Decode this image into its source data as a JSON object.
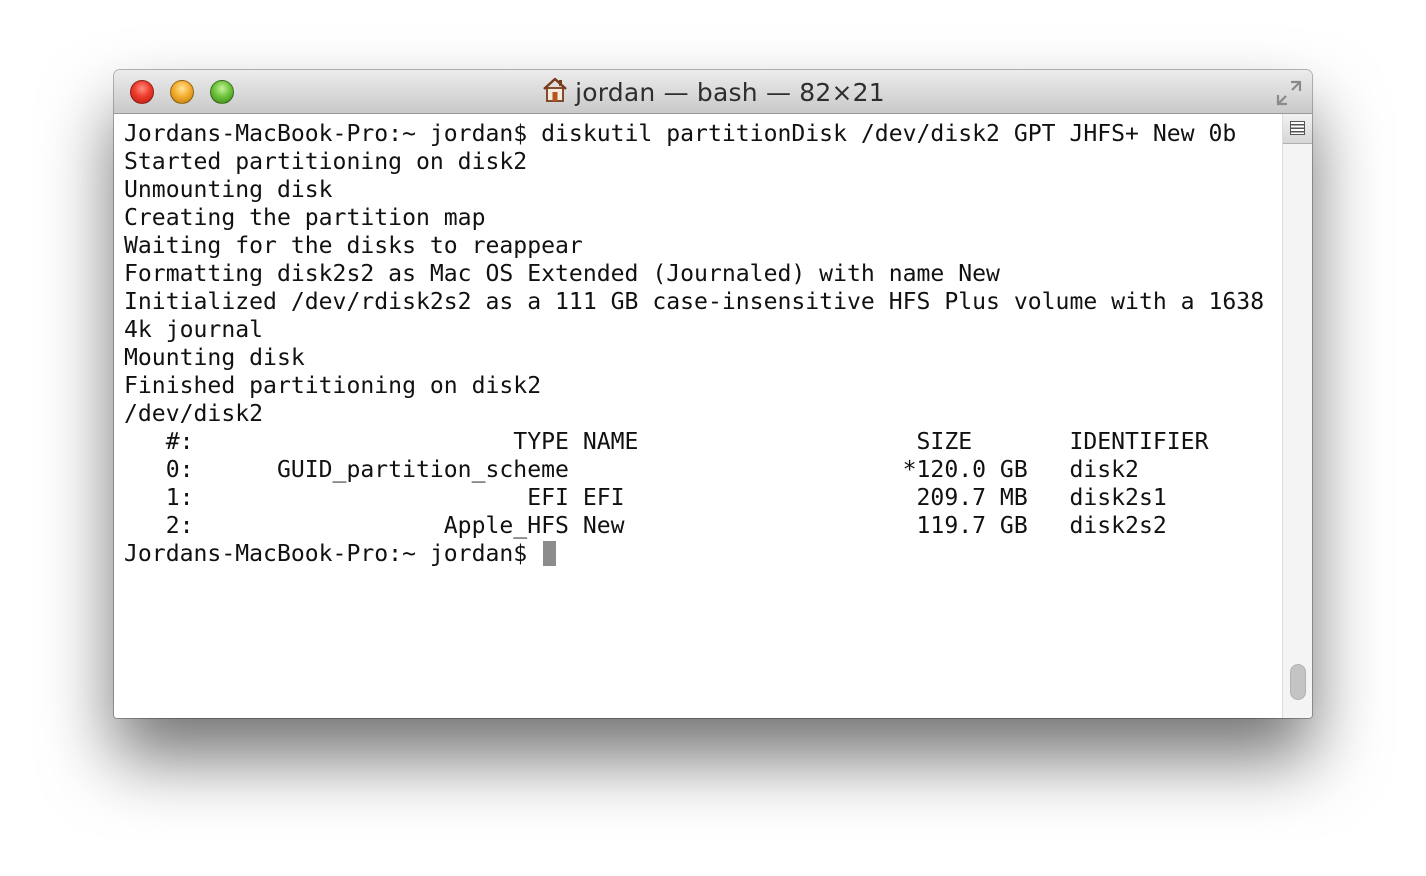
{
  "window": {
    "title": "jordan — bash — 82×21",
    "icons": {
      "title": "home-icon",
      "fullscreen": "fullscreen-icon",
      "split": "split-pane-icon"
    },
    "colors": {
      "close": "#ee3b2b",
      "minimize": "#f5ae2f",
      "zoom": "#6ec43c",
      "cursor": "#8c8c8c"
    }
  },
  "terminal": {
    "lines": [
      "Jordans-MacBook-Pro:~ jordan$ diskutil partitionDisk /dev/disk2 GPT JHFS+ New 0b",
      "Started partitioning on disk2",
      "Unmounting disk",
      "Creating the partition map",
      "Waiting for the disks to reappear",
      "Formatting disk2s2 as Mac OS Extended (Journaled) with name New",
      "Initialized /dev/rdisk2s2 as a 111 GB case-insensitive HFS Plus volume with a 1638",
      "4k journal",
      "Mounting disk",
      "Finished partitioning on disk2",
      "/dev/disk2",
      "   #:                       TYPE NAME                    SIZE       IDENTIFIER",
      "   0:      GUID_partition_scheme                        *120.0 GB   disk2",
      "   1:                        EFI EFI                     209.7 MB   disk2s1",
      "   2:                  Apple_HFS New                     119.7 GB   disk2s2"
    ],
    "prompt": "Jordans-MacBook-Pro:~ jordan$ "
  }
}
